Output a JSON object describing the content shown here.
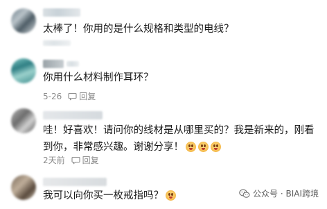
{
  "comments": [
    {
      "text": "太棒了！你用的是什么规格和类型的电线？",
      "date": "",
      "reply": ""
    },
    {
      "text": "你用什么材料制作耳环？",
      "date": "5-26",
      "reply": "回复"
    },
    {
      "text": "哇！好喜欢！请问你的线材是从哪里买的？我是新来的，刚看到你，非常感兴趣。谢谢分享！",
      "date": "2天前",
      "reply": "回复"
    },
    {
      "text": "我可以向你买一枚戒指吗？",
      "date": "",
      "reply": ""
    }
  ],
  "watermark": {
    "text": "公众号 · BIAI跨境"
  },
  "icons": {
    "reply": "comment-bubble-icon",
    "watermark": "wechat-icon",
    "emoji": "surprised-face-emoji-icon"
  }
}
